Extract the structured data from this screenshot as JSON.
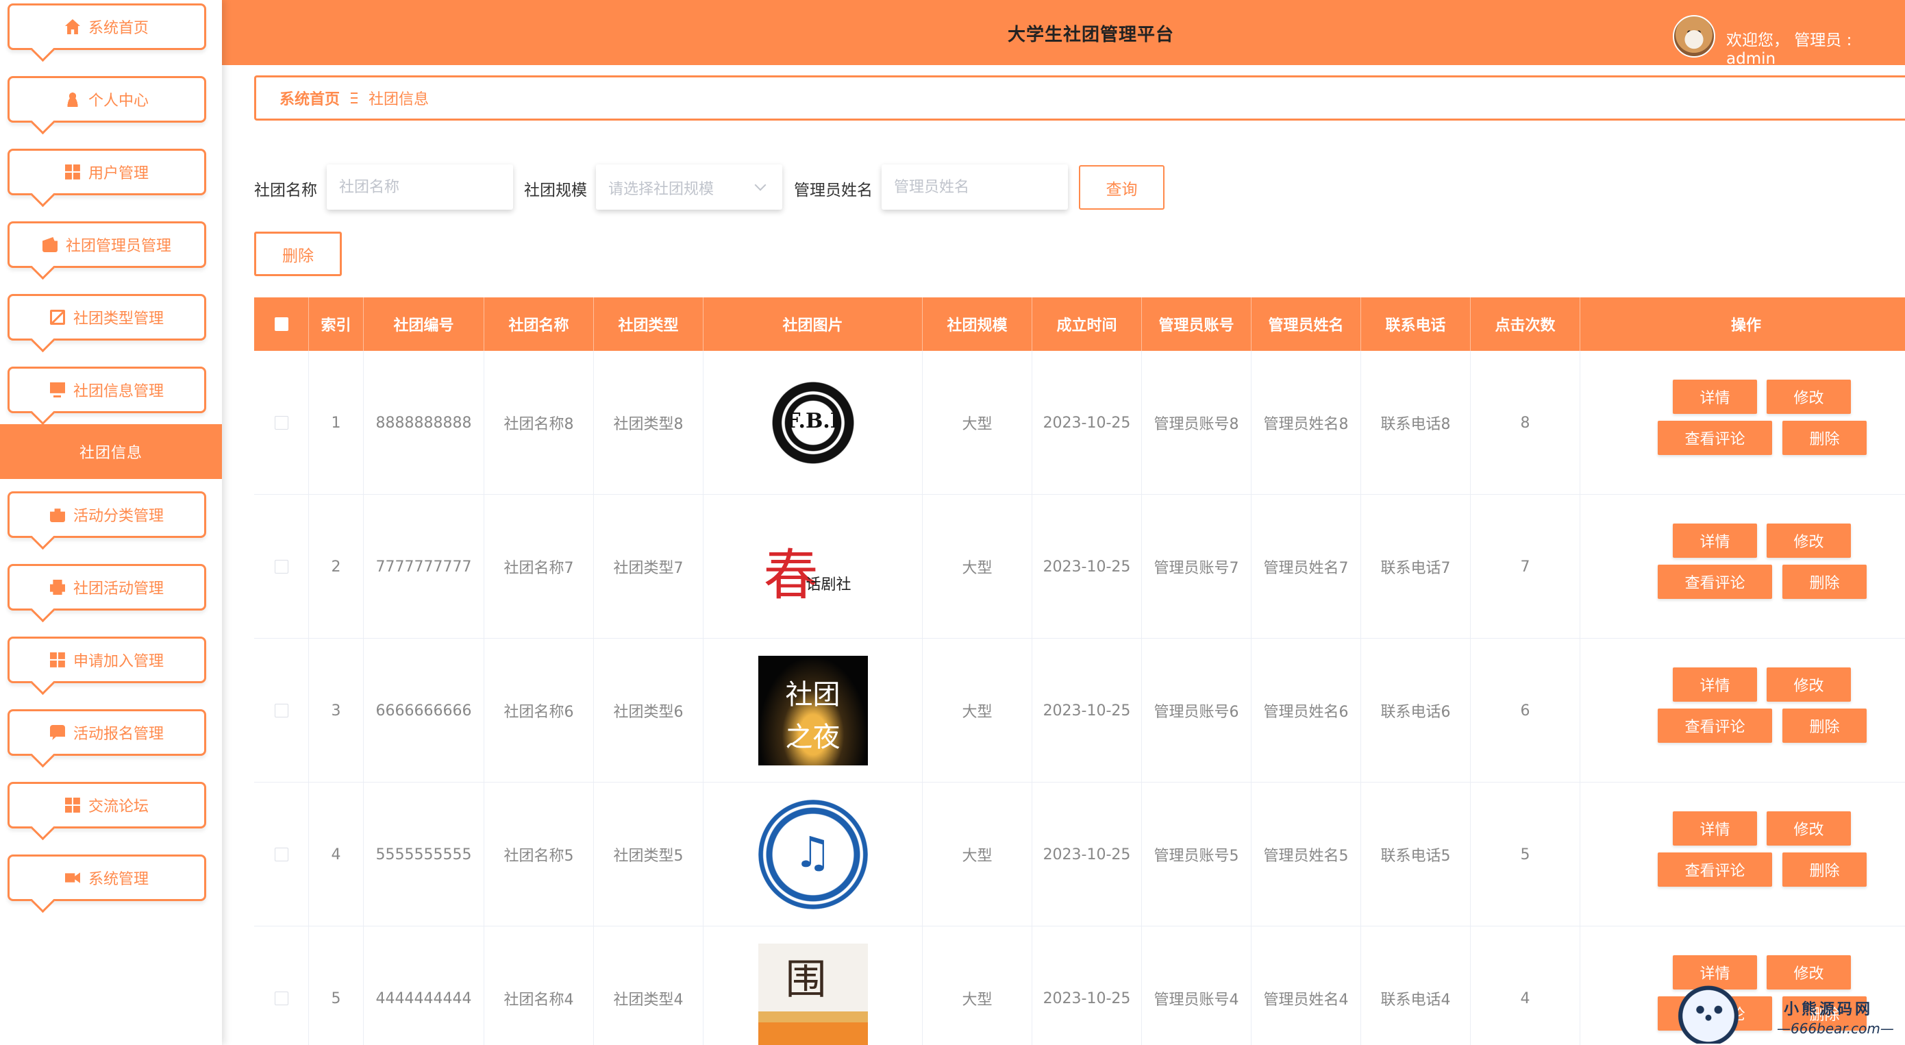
{
  "header": {
    "title": "大学生社团管理平台",
    "welcome": "欢迎您，  管理员 : admin"
  },
  "sidebar": {
    "items": [
      {
        "label": "系统首页",
        "icon": "home-icon"
      },
      {
        "label": "个人中心",
        "icon": "user-icon"
      },
      {
        "label": "用户管理",
        "icon": "grid-icon"
      },
      {
        "label": "社团管理员管理",
        "icon": "wallet-icon"
      },
      {
        "label": "社团类型管理",
        "icon": "chart-icon"
      },
      {
        "label": "社团信息管理",
        "icon": "monitor-icon"
      },
      {
        "label": "活动分类管理",
        "icon": "bag-icon"
      },
      {
        "label": "社团活动管理",
        "icon": "printer-icon"
      },
      {
        "label": "申请加入管理",
        "icon": "grid-icon"
      },
      {
        "label": "活动报名管理",
        "icon": "chat-icon"
      },
      {
        "label": "交流论坛",
        "icon": "grid-icon"
      },
      {
        "label": "系统管理",
        "icon": "video-icon"
      }
    ],
    "active_submenu": "社团信息"
  },
  "breadcrumb": {
    "home": "系统首页",
    "current": "社团信息"
  },
  "search": {
    "name_label": "社团名称",
    "name_placeholder": "社团名称",
    "scale_label": "社团规模",
    "scale_placeholder": "请选择社团规模",
    "admin_label": "管理员姓名",
    "admin_placeholder": "管理员姓名",
    "query_button": "查询"
  },
  "toolbar": {
    "delete_button": "删除"
  },
  "table": {
    "columns": [
      "索引",
      "社团编号",
      "社团名称",
      "社团类型",
      "社团图片",
      "社团规模",
      "成立时间",
      "管理员账号",
      "管理员姓名",
      "联系电话",
      "点击次数",
      "操作"
    ],
    "rows": [
      {
        "index": "1",
        "code": "8888888888",
        "name": "社团名称8",
        "type": "社团类型8",
        "logo": "logo-fbi",
        "logo_text": "F.B.I",
        "scale": "大型",
        "date": "2023-10-25",
        "account": "管理员账号8",
        "admin": "管理员姓名8",
        "phone": "联系电话8",
        "clicks": "8"
      },
      {
        "index": "2",
        "code": "7777777777",
        "name": "社团名称7",
        "type": "社团类型7",
        "logo": "logo-drama",
        "logo_text": "话剧社",
        "scale": "大型",
        "date": "2023-10-25",
        "account": "管理员账号7",
        "admin": "管理员姓名7",
        "phone": "联系电话7",
        "clicks": "7"
      },
      {
        "index": "3",
        "code": "6666666666",
        "name": "社团名称6",
        "type": "社团类型6",
        "logo": "logo-night",
        "logo_text": "社团之夜",
        "scale": "大型",
        "date": "2023-10-25",
        "account": "管理员账号6",
        "admin": "管理员姓名6",
        "phone": "联系电话6",
        "clicks": "6"
      },
      {
        "index": "4",
        "code": "5555555555",
        "name": "社团名称5",
        "type": "社团类型5",
        "logo": "logo-music",
        "logo_text": "",
        "scale": "大型",
        "date": "2023-10-25",
        "account": "管理员账号5",
        "admin": "管理员姓名5",
        "phone": "联系电话5",
        "clicks": "5"
      },
      {
        "index": "5",
        "code": "4444444444",
        "name": "社团名称4",
        "type": "社团类型4",
        "logo": "logo-tower",
        "logo_text": "",
        "scale": "大型",
        "date": "2023-10-25",
        "account": "管理员账号4",
        "admin": "管理员姓名4",
        "phone": "联系电话4",
        "clicks": "4"
      }
    ],
    "actions": {
      "detail": "详情",
      "edit": "修改",
      "comments": "查看评论",
      "delete": "删除"
    }
  },
  "watermark": {
    "line1": "小熊源码网",
    "line2": "—666bear.com—"
  },
  "colors": {
    "accent": "#ff8a4c",
    "header_text": "#222222",
    "cell_text": "#888888"
  }
}
